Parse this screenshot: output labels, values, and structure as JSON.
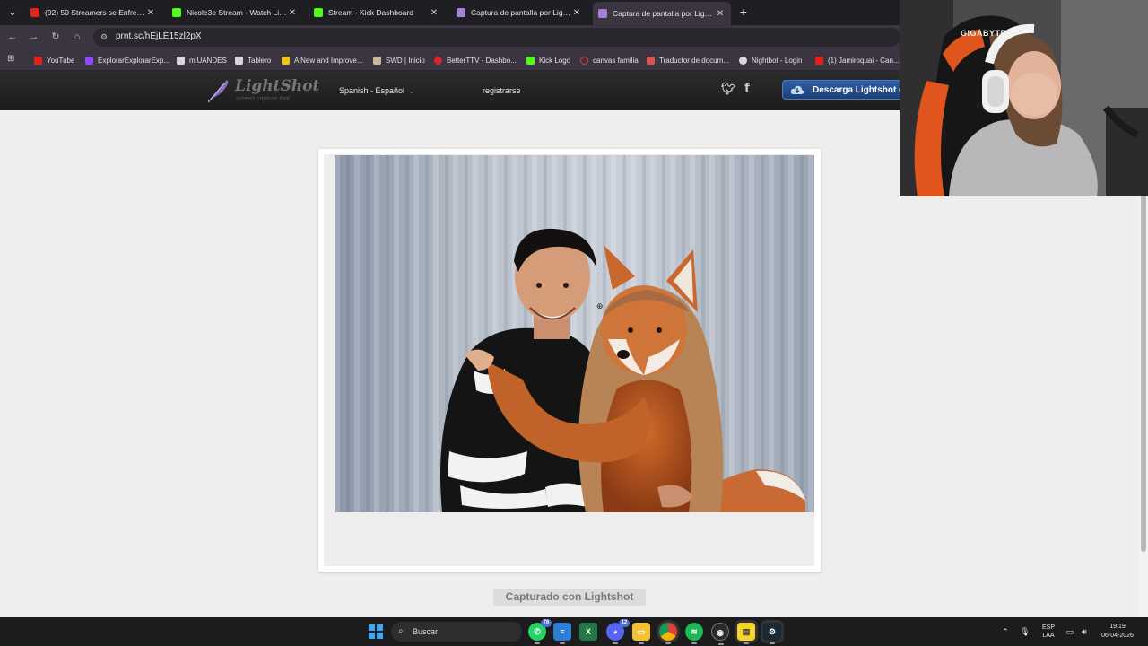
{
  "browser": {
    "tabs": [
      {
        "title": "(92) 50 Streamers se Enfrentan",
        "icon": "youtube-icon",
        "color": "#e62117"
      },
      {
        "title": "Nicole3e Stream - Watch Live o",
        "icon": "kick-icon",
        "color": "#53fc18"
      },
      {
        "title": "Stream - Kick Dashboard",
        "icon": "kick-icon",
        "color": "#53fc18"
      },
      {
        "title": "Captura de pantalla por Lightsh",
        "icon": "lightshot-icon",
        "color": "#a57fd8"
      },
      {
        "title": "Captura de pantalla por Lightsh",
        "icon": "lightshot-icon",
        "color": "#a57fd8"
      }
    ],
    "active_tab_index": 4,
    "new_tab_label": "+",
    "url": "prnt.sc/hEjLE15zl2pX",
    "bookmarks": [
      {
        "label": "YouTube",
        "color": "#e62117"
      },
      {
        "label": "ExplorarExplorarExp...",
        "color": "#9147ff"
      },
      {
        "label": "miUANDES",
        "color": "#d8d8d8"
      },
      {
        "label": "Tablero",
        "color": "#d8d8d8"
      },
      {
        "label": "A New and Improve...",
        "color": "#f0c419"
      },
      {
        "label": "SWD | Inicio",
        "color": "#c8b89a"
      },
      {
        "label": "BetterTTV - Dashbo...",
        "color": "#d9262c"
      },
      {
        "label": "Kick Logo",
        "color": "#53fc18"
      },
      {
        "label": "canvas familia",
        "color": "#e23b3b"
      },
      {
        "label": "Traductor de docum...",
        "color": "#d9534f"
      },
      {
        "label": "Nightbot - Login",
        "color": "#d8d8d8"
      },
      {
        "label": "(1) Jamiroquai - Can...",
        "color": "#e62117"
      }
    ]
  },
  "lightshot": {
    "logo_name": "LightShot",
    "logo_tagline": "screen capture tool",
    "language": "Spanish - Español",
    "register": "registrarse",
    "download_button": "Descarga Lightshot g",
    "captured_with": "Capturado con Lightshot",
    "accent_color": "#2f5ea5"
  },
  "webcam": {
    "chair_brand": "GIGABYTE"
  },
  "taskbar": {
    "search_placeholder": "Buscar",
    "apps": [
      {
        "name": "whatsapp",
        "badge": "76"
      },
      {
        "name": "notepad",
        "badge": ""
      },
      {
        "name": "excel",
        "badge": ""
      },
      {
        "name": "discord",
        "badge": "12"
      },
      {
        "name": "file-explorer",
        "badge": ""
      },
      {
        "name": "chrome",
        "badge": ""
      },
      {
        "name": "spotify",
        "badge": ""
      },
      {
        "name": "obs",
        "badge": ""
      },
      {
        "name": "sticky-notes",
        "badge": ""
      },
      {
        "name": "steam",
        "badge": ""
      }
    ],
    "language_top": "ESP",
    "language_bottom": "LAA",
    "time": "19:19",
    "date": "06-04-2026"
  }
}
